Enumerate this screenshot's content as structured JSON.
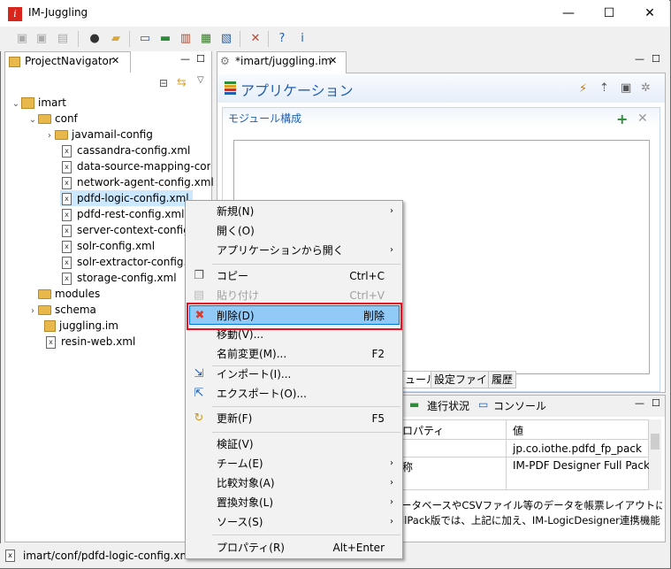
{
  "window": {
    "title": "IM-Juggling",
    "minimize": "—",
    "maximize": "☐",
    "close": "✕"
  },
  "navigator": {
    "tab_label": "ProjectNavigator",
    "tab_close": "✕",
    "tree": [
      {
        "label": "imart"
      },
      {
        "label": "conf"
      },
      {
        "label": "javamail-config"
      },
      {
        "label": "cassandra-config.xml"
      },
      {
        "label": "data-source-mapping-config"
      },
      {
        "label": "network-agent-config.xml"
      },
      {
        "label": "pdfd-logic-config.xml"
      },
      {
        "label": "pdfd-rest-config.xml"
      },
      {
        "label": "server-context-config.x"
      },
      {
        "label": "solr-config.xml"
      },
      {
        "label": "solr-extractor-config.x"
      },
      {
        "label": "storage-config.xml"
      },
      {
        "label": "modules"
      },
      {
        "label": "schema"
      },
      {
        "label": "juggling.im"
      },
      {
        "label": "resin-web.xml"
      }
    ]
  },
  "editor": {
    "tab_label": "*imart/juggling.im",
    "tab_close": "✕",
    "heading": "アプリケーション",
    "section_title": "モジュール構成",
    "bottom_tabs": [
      "ュール",
      "設定ファイル",
      "履歴"
    ]
  },
  "bottom_panel": {
    "tabs": [
      "進行状況",
      "コンソール"
    ],
    "col_property": "ロパティ",
    "col_value": "値",
    "rows": [
      {
        "key": "",
        "value": "jp.co.iothe.pdfd_fp_pack"
      },
      {
        "key": "称",
        "value": "IM-PDF Designer Full Pack fo"
      }
    ],
    "description_1": "ータベースやCSVファイル等のデータを帳票レイアウトに埋め込み、",
    "description_2": "llPack版では、上記に加え、IM-LogicDesigner連携機能とR"
  },
  "context_menu": {
    "items": [
      {
        "label": "新規(N)",
        "shortcut": "",
        "submenu": true
      },
      {
        "label": "開く(O)",
        "shortcut": "",
        "submenu": false
      },
      {
        "label": "アプリケーションから開く",
        "shortcut": "",
        "submenu": true
      },
      {
        "label": "コピー",
        "shortcut": "Ctrl+C",
        "submenu": false
      },
      {
        "label": "貼り付け",
        "shortcut": "Ctrl+V",
        "submenu": false,
        "disabled": true
      },
      {
        "label": "削除(D)",
        "shortcut": "削除",
        "submenu": false,
        "highlighted": true
      },
      {
        "label": "移動(V)...",
        "shortcut": "",
        "submenu": false
      },
      {
        "label": "名前変更(M)...",
        "shortcut": "F2",
        "submenu": false
      },
      {
        "label": "インポート(I)...",
        "shortcut": "",
        "submenu": false
      },
      {
        "label": "エクスポート(O)...",
        "shortcut": "",
        "submenu": false
      },
      {
        "label": "更新(F)",
        "shortcut": "F5",
        "submenu": false
      },
      {
        "label": "検証(V)",
        "shortcut": "",
        "submenu": false
      },
      {
        "label": "チーム(E)",
        "shortcut": "",
        "submenu": true
      },
      {
        "label": "比較対象(A)",
        "shortcut": "",
        "submenu": true
      },
      {
        "label": "置換対象(L)",
        "shortcut": "",
        "submenu": true
      },
      {
        "label": "ソース(S)",
        "shortcut": "",
        "submenu": true
      },
      {
        "label": "プロパティ(R)",
        "shortcut": "Alt+Enter",
        "submenu": false
      }
    ]
  },
  "status_bar": {
    "path": "imart/conf/pdfd-logic-config.xml"
  },
  "colors": {
    "highlight": "#91c9f7",
    "highlight_border": "#0078d7",
    "red_box": "#e81123",
    "heading_blue": "#1f5fb4"
  }
}
